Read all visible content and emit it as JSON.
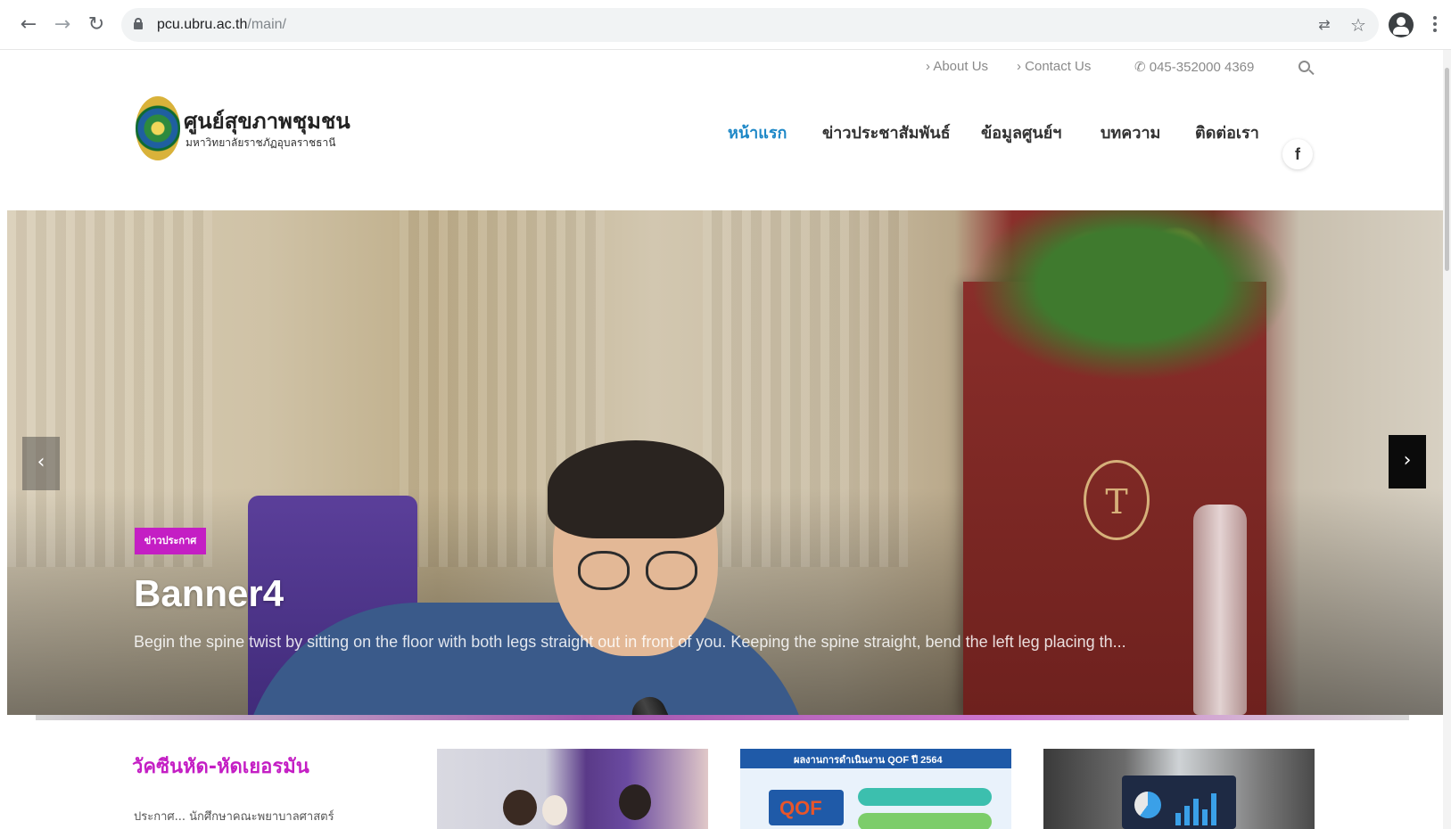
{
  "browser": {
    "url_host": "pcu.ubru.ac.th",
    "url_path": "/main/",
    "icons": [
      "back-arrow-icon",
      "forward-arrow-icon",
      "reload-icon",
      "lock-icon",
      "translate-icon",
      "star-icon",
      "profile-icon",
      "kebab-menu-icon"
    ]
  },
  "topbar": {
    "about": "› About Us",
    "contact": "› Contact Us",
    "phone": "✆ 045-352000 4369"
  },
  "brand": {
    "title": "ศูนย์สุขภาพชุมชน",
    "subtitle": "มหาวิทยาลัยราชภัฏอุบลราชธานี"
  },
  "nav": {
    "items": [
      "หน้าแรก",
      "ข่าวประชาสัมพันธ์",
      "ข้อมูลศูนย์ฯ",
      "บทความ",
      "ติดต่อเรา"
    ],
    "active": "หน้าแรก",
    "facebook": "f"
  },
  "hero": {
    "tag": "ข่าวประกาศ",
    "title": "Banner4",
    "description": "Begin the spine twist by sitting on the floor with both legs straight out in front of you. Keeping the spine straight, bend the left leg placing th...",
    "prev": "‹",
    "next": "›"
  },
  "news": {
    "title": "วัคซีนหัด-หัดเยอรมัน",
    "excerpt": "ประกาศ... นักศึกษาคณะพยาบาลศาสตร์"
  },
  "thumbs": {
    "qof_header": "ผลงานการดำเนินงาน QOF ปี 2564",
    "qof_logo": "QOF"
  },
  "colors": {
    "accent_nav": "#1e88c7",
    "accent_tag": "#c41ec4"
  }
}
